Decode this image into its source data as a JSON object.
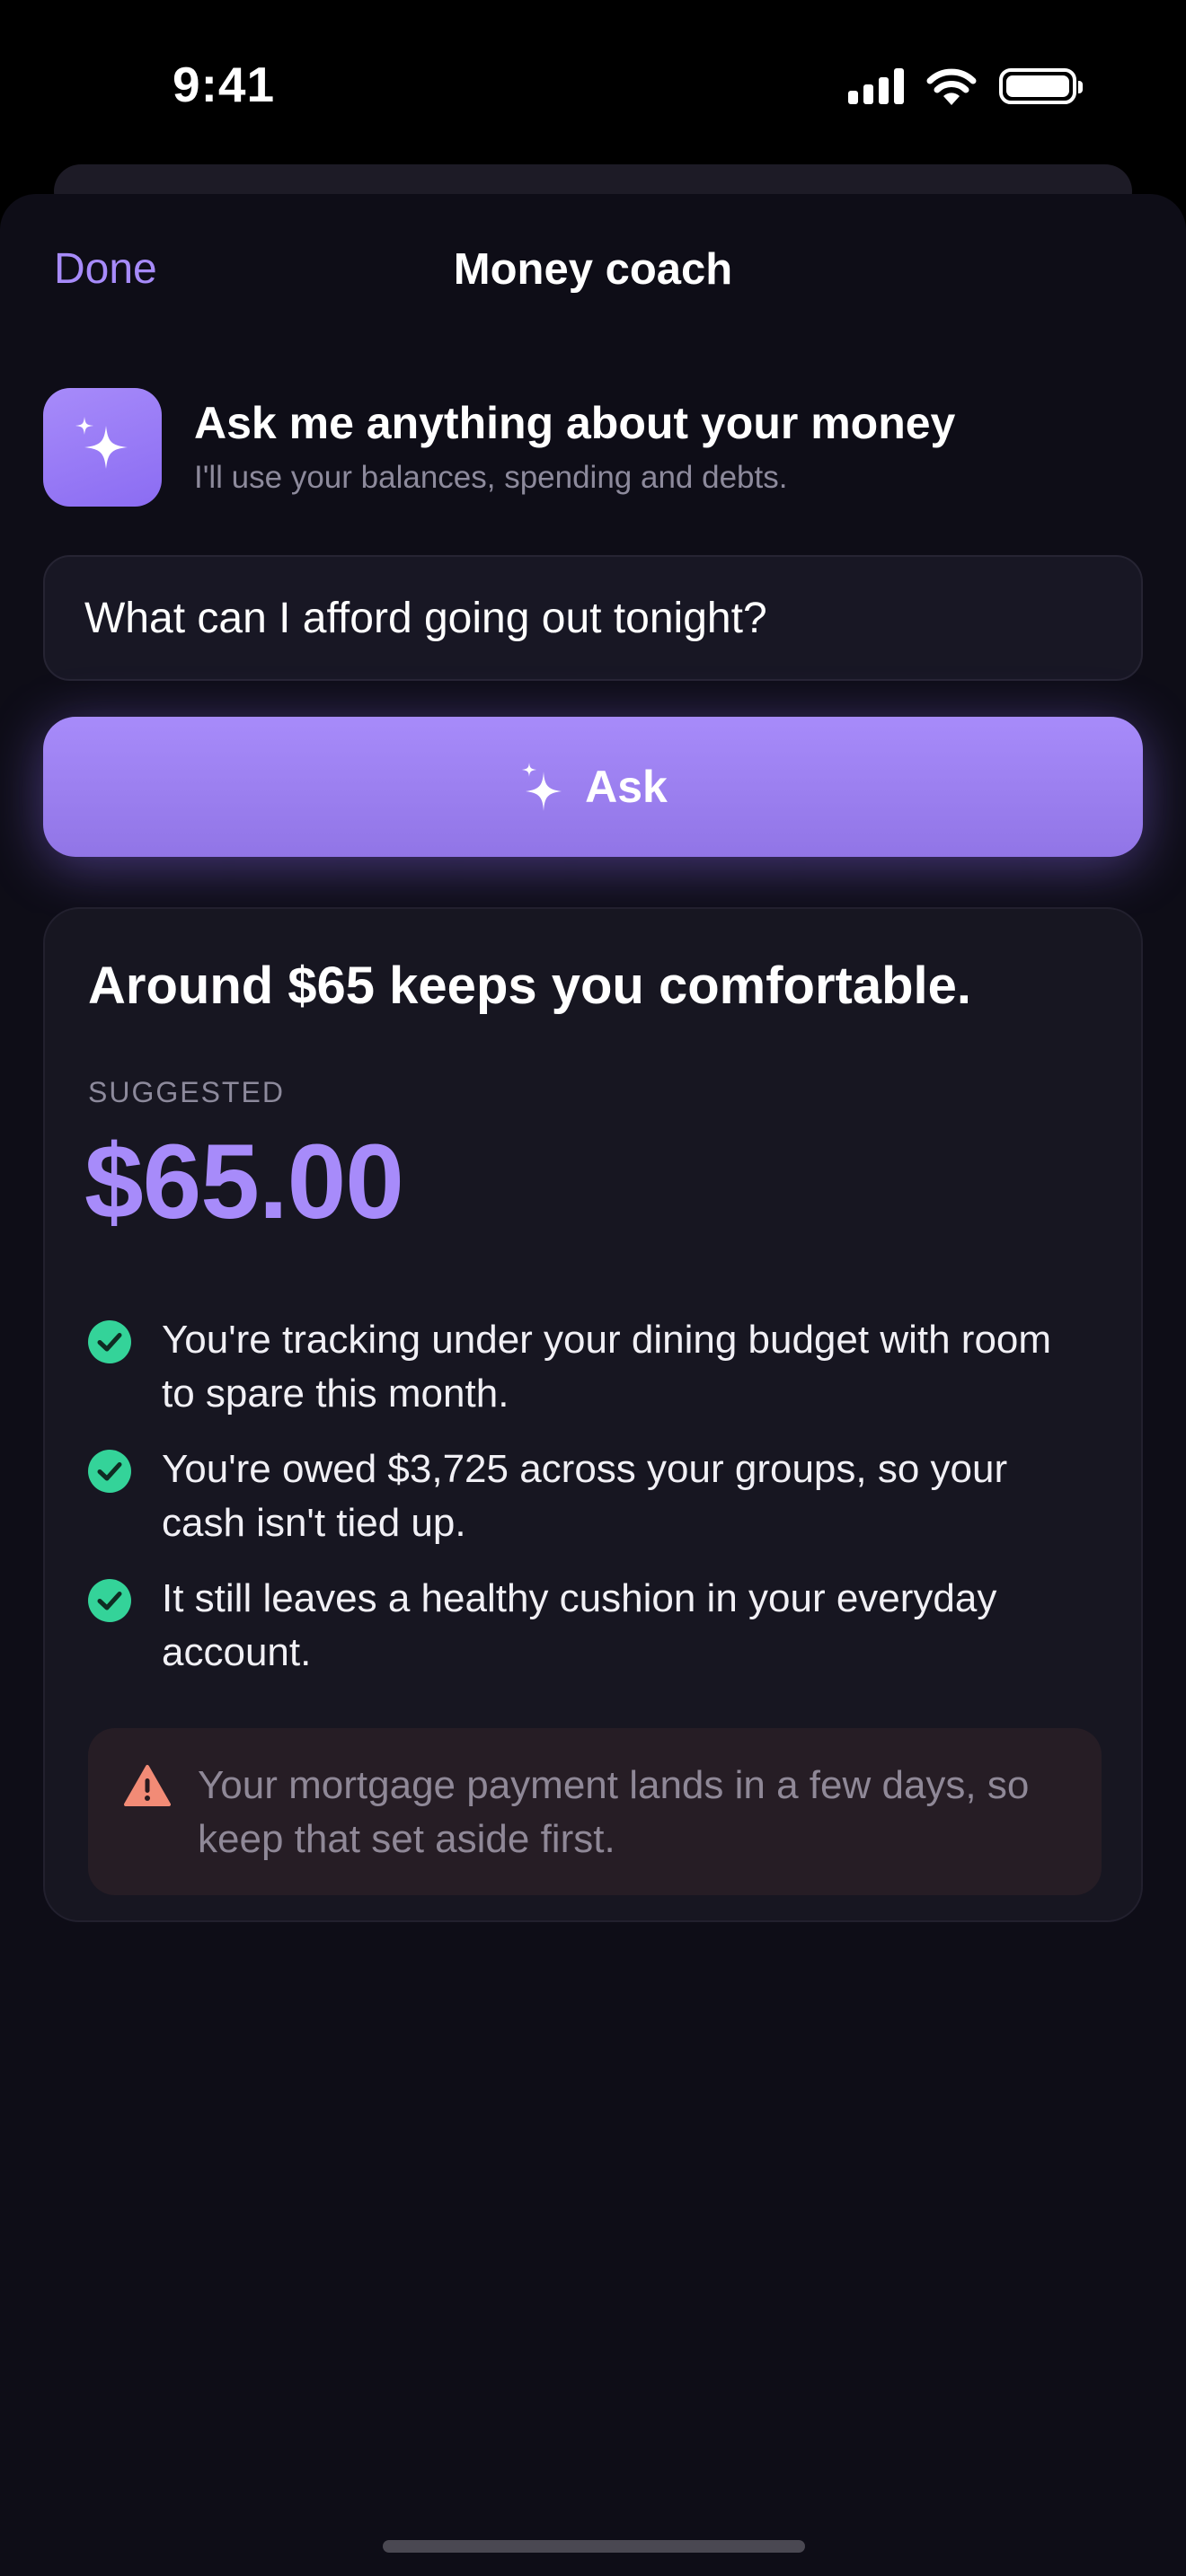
{
  "status_bar": {
    "time": "9:41"
  },
  "nav": {
    "done_label": "Done",
    "title": "Money coach"
  },
  "intro": {
    "icon": "sparkles-icon",
    "title": "Ask me anything about your money",
    "subtitle": "I'll use your balances, spending and debts."
  },
  "question": {
    "value": "What can I afford going out tonight?"
  },
  "ask_button": {
    "label": "Ask",
    "icon": "sparkles-icon"
  },
  "answer": {
    "headline": "Around $65 keeps you comfortable.",
    "suggested_label": "SUGGESTED",
    "amount": "$65.00",
    "reasons": [
      "You're tracking under your dining budget with room to spare this month.",
      "You're owed $3,725 across your groups, so your cash isn't tied up.",
      "It still leaves a healthy cushion in your everyday account."
    ],
    "warning": "Your mortgage payment lands in a few days, so keep that set aside first."
  },
  "colors": {
    "accent": "#a78bfa",
    "background": "#0e0d17",
    "card": "#171621",
    "success": "#34d399",
    "warning": "#f28b76"
  }
}
